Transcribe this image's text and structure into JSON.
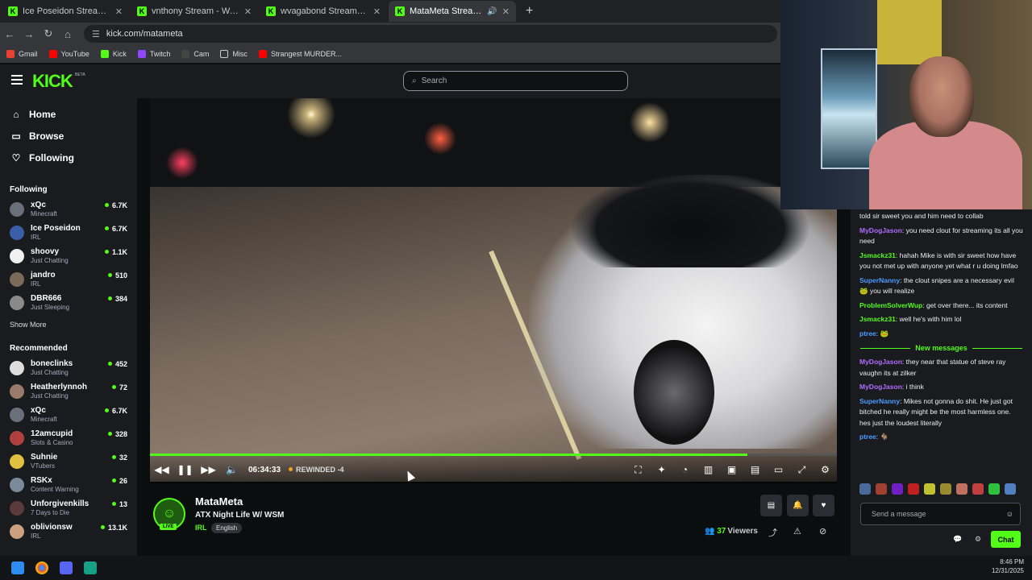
{
  "browser": {
    "tabs": [
      {
        "title": "Ice Poseidon Stream - Watch Live on Kick",
        "active": false
      },
      {
        "title": "vnthony Stream - Watch Live on Kick",
        "active": false
      },
      {
        "title": "wvagabond Stream - Watch Live on Kick",
        "active": false
      },
      {
        "title": "MataMeta Stream - Watch Live on Kick",
        "active": true
      }
    ],
    "url": "kick.com/matameta",
    "bookmarks": [
      "Gmail",
      "YouTube",
      "Kick",
      "Twitch",
      "Cam",
      "Misc",
      "Strangest MURDER..."
    ]
  },
  "site": {
    "logo": "KICK",
    "beta": "BETA",
    "search_placeholder": "Search"
  },
  "sidebar": {
    "nav": [
      "Home",
      "Browse",
      "Following"
    ],
    "following_heading": "Following",
    "following": [
      {
        "name": "xQc",
        "category": "Minecraft",
        "viewers": "6.7K",
        "color": "#6b6f7a"
      },
      {
        "name": "Ice Poseidon",
        "category": "IRL",
        "viewers": "6.7K",
        "color": "#3b5ea8"
      },
      {
        "name": "shoovy",
        "category": "Just Chatting",
        "viewers": "1.1K",
        "color": "#f0f0f0"
      },
      {
        "name": "jandro",
        "category": "IRL",
        "viewers": "510",
        "color": "#7a6a5a"
      },
      {
        "name": "DBR666",
        "category": "Just Sleeping",
        "viewers": "384",
        "color": "#8a8a8a"
      }
    ],
    "show_more": "Show More",
    "recommended_heading": "Recommended",
    "recommended": [
      {
        "name": "boneclinks",
        "category": "Just Chatting",
        "viewers": "452",
        "color": "#ddd"
      },
      {
        "name": "Heatherlynnoh",
        "category": "Just Chatting",
        "viewers": "72",
        "color": "#9a7a6a"
      },
      {
        "name": "xQc",
        "category": "Minecraft",
        "viewers": "6.7K",
        "color": "#6b6f7a"
      },
      {
        "name": "12amcupid",
        "category": "Slots & Casino",
        "viewers": "328",
        "color": "#b04040"
      },
      {
        "name": "Suhnie",
        "category": "VTubers",
        "viewers": "32",
        "color": "#e0c040"
      },
      {
        "name": "RSKx",
        "category": "Content Warning",
        "viewers": "26",
        "color": "#7a8a9a"
      },
      {
        "name": "Unforgivenkills",
        "category": "7 Days to Die",
        "viewers": "13",
        "color": "#5a3a3a"
      },
      {
        "name": "oblivionsw",
        "category": "IRL",
        "viewers": "13.1K",
        "color": "#caa080"
      }
    ]
  },
  "player": {
    "time": "06:34:33",
    "status": "REWINDED -4",
    "progress": 0.87
  },
  "stream": {
    "streamer": "MataMeta",
    "title": "ATX Night Life W/ WSM",
    "category": "IRL",
    "language": "English",
    "live_label": "LIVE",
    "viewer_count": "37",
    "viewer_label": "Viewers"
  },
  "chat": {
    "messages_before": [
      {
        "user": "",
        "text": "told sir sweet you and him need to collab",
        "color": "#ffffff"
      },
      {
        "user": "MyDogJason",
        "text": "you need clout for streaming its all you need",
        "color": "#b06cff"
      },
      {
        "user": "Jsmackz31",
        "text": "hahah Mike is with sir sweet how have you not met up with anyone yet what r u doing lmfao",
        "color": "#53fc18"
      },
      {
        "user": "SuperNanny",
        "text": "the clout snipes are a necessary evil 🐸 you will realize",
        "color": "#4d9bff"
      },
      {
        "user": "ProblemSolverWup",
        "text": "get over there... its content",
        "color": "#53fc18"
      },
      {
        "user": "Jsmackz31",
        "text": "well he's with him lol",
        "color": "#53fc18"
      },
      {
        "user": "ptree",
        "text": "🐸",
        "color": "#4d9bff"
      }
    ],
    "new_messages_label": "New messages",
    "messages_after": [
      {
        "user": "MyDogJason",
        "text": "they near that statue of steve ray vaughn its at zilker",
        "color": "#b06cff"
      },
      {
        "user": "MyDogJason",
        "text": "i think",
        "color": "#b06cff"
      },
      {
        "user": "SuperNanny",
        "text": "Mikes not gonna do shit. He just got bitched he really might be the most harmless one. hes just the loudest literally",
        "color": "#4d9bff"
      },
      {
        "user": "ptree",
        "text": "🐐",
        "color": "#4d9bff"
      }
    ],
    "input_placeholder": "Send a message",
    "send_label": "Chat"
  },
  "taskbar": {
    "time": "8:46 PM",
    "date": "12/31/2025"
  }
}
